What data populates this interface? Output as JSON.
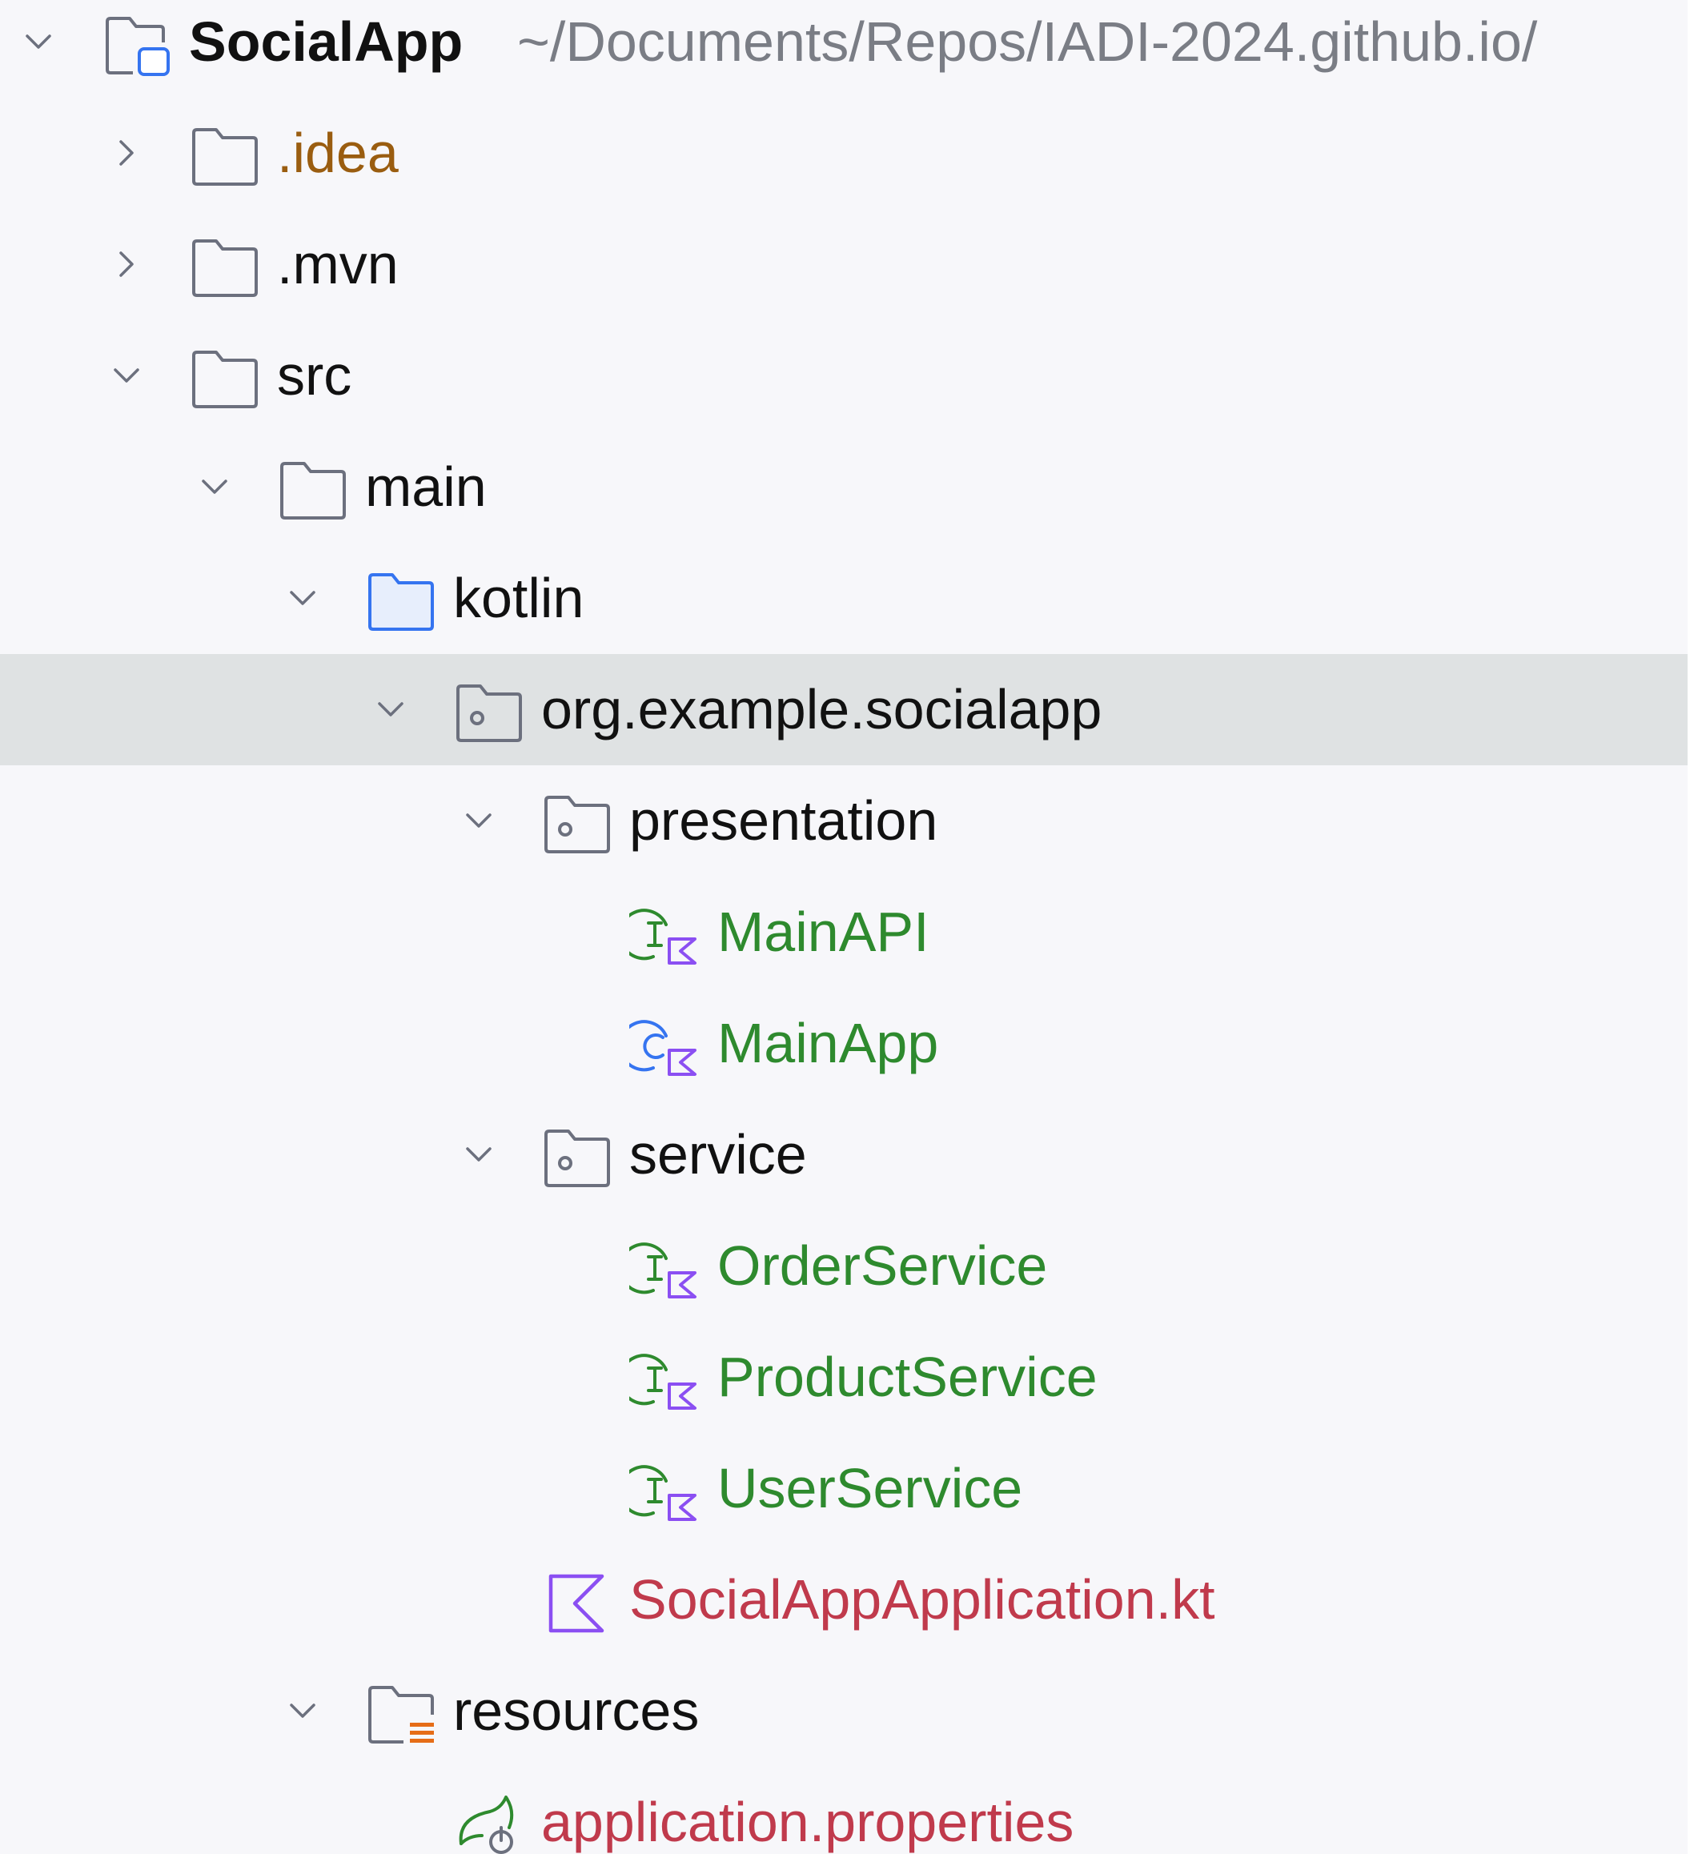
{
  "project_tree": {
    "root": {
      "name": "SocialApp",
      "path": "~/Documents/Repos/IADI-2024.github.io/"
    },
    "nodes": [
      {
        "label": ".idea",
        "icon": "folder-icon",
        "expanded": false,
        "status": "excluded"
      },
      {
        "label": ".mvn",
        "icon": "folder-icon",
        "expanded": false,
        "status": "default"
      },
      {
        "label": "src",
        "icon": "folder-icon",
        "expanded": true,
        "status": "default"
      },
      {
        "label": "main",
        "icon": "folder-icon",
        "expanded": true,
        "status": "default"
      },
      {
        "label": "kotlin",
        "icon": "source-root-folder-icon",
        "expanded": true,
        "status": "default"
      },
      {
        "label": "org.example.socialapp",
        "icon": "package-icon",
        "expanded": true,
        "status": "default",
        "selected": true
      },
      {
        "label": "presentation",
        "icon": "package-icon",
        "expanded": true,
        "status": "default"
      },
      {
        "label": "MainAPI",
        "icon": "kotlin-interface-icon",
        "status": "added"
      },
      {
        "label": "MainApp",
        "icon": "kotlin-class-icon",
        "status": "added"
      },
      {
        "label": "service",
        "icon": "package-icon",
        "expanded": true,
        "status": "default"
      },
      {
        "label": "OrderService",
        "icon": "kotlin-interface-icon",
        "status": "added"
      },
      {
        "label": "ProductService",
        "icon": "kotlin-interface-icon",
        "status": "added"
      },
      {
        "label": "UserService",
        "icon": "kotlin-interface-icon",
        "status": "added"
      },
      {
        "label": "SocialAppApplication.kt",
        "icon": "kotlin-file-icon",
        "status": "modified"
      },
      {
        "label": "resources",
        "icon": "resources-folder-icon",
        "expanded": true,
        "status": "default"
      },
      {
        "label": "application.properties",
        "icon": "spring-properties-icon",
        "status": "modified"
      }
    ]
  },
  "colors": {
    "background": "#f7f7fa",
    "selected_row": "#dfe2e3",
    "text_default": "#111111",
    "text_path": "#7a7d85",
    "text_excluded": "#9a5d10",
    "text_added": "#2e8a2e",
    "text_modified": "#c03a4c",
    "icon_gray": "#6c707e",
    "icon_blue": "#3574f0",
    "icon_green": "#2e8a2e",
    "icon_kotlin": "#8b4ff2",
    "icon_orange": "#e66d17"
  }
}
